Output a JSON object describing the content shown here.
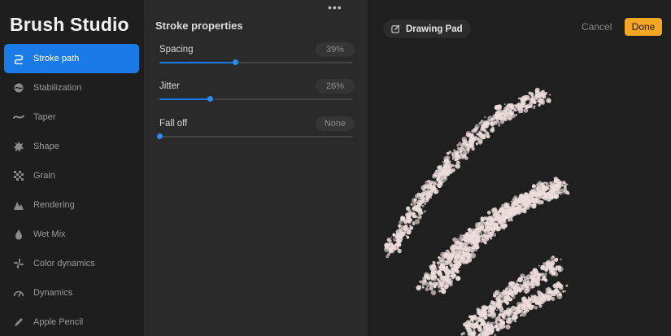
{
  "app": {
    "title": "Brush Studio"
  },
  "sidebar": {
    "items": [
      {
        "label": "Stroke path",
        "icon": "stroke-path-icon",
        "active": true
      },
      {
        "label": "Stabilization",
        "icon": "stabilization-icon"
      },
      {
        "label": "Taper",
        "icon": "taper-icon"
      },
      {
        "label": "Shape",
        "icon": "shape-icon"
      },
      {
        "label": "Grain",
        "icon": "grain-icon"
      },
      {
        "label": "Rendering",
        "icon": "rendering-icon"
      },
      {
        "label": "Wet Mix",
        "icon": "wet-mix-icon"
      },
      {
        "label": "Color dynamics",
        "icon": "color-dynamics-icon"
      },
      {
        "label": "Dynamics",
        "icon": "dynamics-icon"
      },
      {
        "label": "Apple Pencil",
        "icon": "apple-pencil-icon"
      }
    ]
  },
  "panel": {
    "title": "Stroke properties",
    "more_icon": "more-icon",
    "properties": [
      {
        "label": "Spacing",
        "value": "39%",
        "level": 0.39
      },
      {
        "label": "Jitter",
        "value": "26%",
        "level": 0.26
      },
      {
        "label": "Fall off",
        "value": "None",
        "level": 0
      }
    ]
  },
  "pad": {
    "tab_label": "Drawing Pad",
    "tab_icon": "edit-icon",
    "cancel_label": "Cancel",
    "done_label": "Done"
  },
  "colors": {
    "accent": "#1a7ae6",
    "done": "#f5a623",
    "stroke": "#ecdcdc"
  }
}
